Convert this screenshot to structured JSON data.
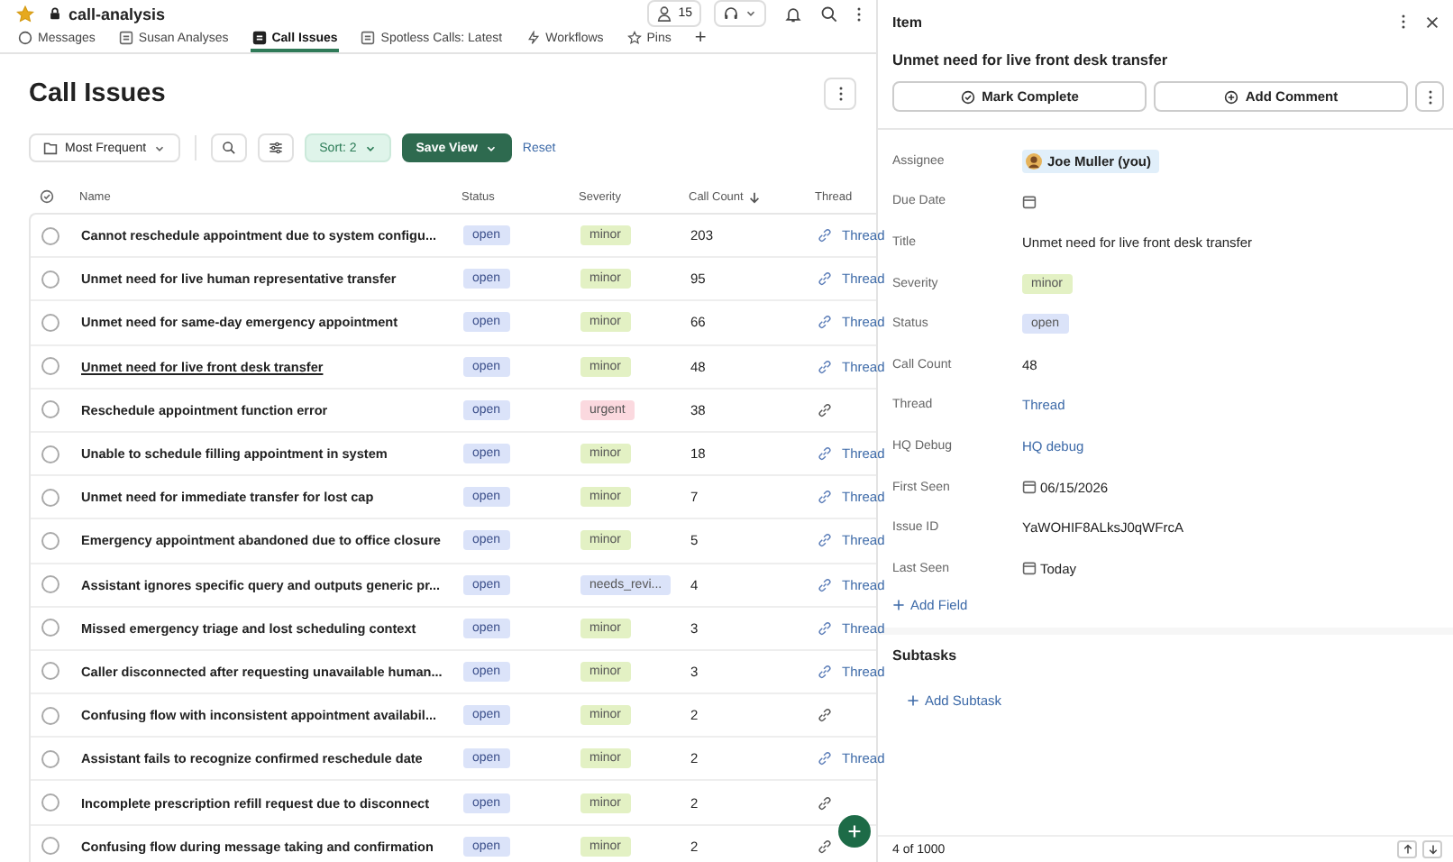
{
  "channel": {
    "name": "call-analysis",
    "starred": true,
    "member_count": "15"
  },
  "tabs": [
    {
      "label": "Messages",
      "kind": "chat",
      "selected": false
    },
    {
      "label": "Susan Analyses",
      "kind": "doc",
      "selected": false
    },
    {
      "label": "Call Issues",
      "kind": "doc",
      "selected": true
    },
    {
      "label": "Spotless Calls: Latest",
      "kind": "doc",
      "selected": false
    },
    {
      "label": "Workflows",
      "kind": "flow",
      "selected": false
    },
    {
      "label": "Pins",
      "kind": "pin",
      "selected": false
    }
  ],
  "add_tab": "+",
  "page_title": "Call Issues",
  "toolbar": {
    "view": "Most Frequent",
    "sort": "Sort: 2",
    "save": "Save View",
    "reset": "Reset"
  },
  "table": {
    "columns": [
      "Name",
      "Status",
      "Severity",
      "Call Count",
      "Thread"
    ],
    "rows": [
      {
        "checked": false,
        "name": "Cannot reschedule appointment due to system configu...",
        "status": "open",
        "severity": {
          "text": "minor",
          "color": "#e3f1c4"
        },
        "count": "203",
        "thread": "Thread",
        "selected": false
      },
      {
        "checked": false,
        "name": "Unmet need for live human representative transfer",
        "status": "open",
        "severity": {
          "text": "minor",
          "color": "#e3f1c4"
        },
        "count": "95",
        "thread": "Thread",
        "selected": false
      },
      {
        "checked": false,
        "name": "Unmet need for same-day emergency appointment",
        "status": "open",
        "severity": {
          "text": "minor",
          "color": "#e3f1c4"
        },
        "count": "66",
        "thread": "Thread",
        "selected": false
      },
      {
        "checked": false,
        "name": "Unmet need for live front desk transfer",
        "status": "open",
        "severity": {
          "text": "minor",
          "color": "#e3f1c4"
        },
        "count": "48",
        "thread": "Thread",
        "selected": true
      },
      {
        "checked": false,
        "name": "Reschedule appointment function error",
        "status": "open",
        "severity": {
          "text": "urgent",
          "color": "#fbd9df"
        },
        "count": "38",
        "selected": false
      },
      {
        "checked": false,
        "name": "Unable to schedule filling appointment in system",
        "status": "open",
        "severity": {
          "text": "minor",
          "color": "#e3f1c4"
        },
        "count": "18",
        "thread": "Thread",
        "selected": false
      },
      {
        "checked": false,
        "name": "Unmet need for immediate transfer for lost cap",
        "status": "open",
        "severity": {
          "text": "minor",
          "color": "#e3f1c4"
        },
        "count": "7",
        "thread": "Thread",
        "selected": false
      },
      {
        "checked": false,
        "name": "Emergency appointment abandoned due to office closure",
        "status": "open",
        "severity": {
          "text": "minor",
          "color": "#e3f1c4"
        },
        "count": "5",
        "thread": "Thread",
        "selected": false
      },
      {
        "checked": false,
        "name": "Assistant ignores specific query and outputs generic pr...",
        "status": "open",
        "severity": {
          "text": "needs_revi...",
          "color": "#dbe3f9"
        },
        "count": "4",
        "thread": "Thread",
        "selected": false
      },
      {
        "checked": false,
        "name": "Missed emergency triage and lost scheduling context",
        "status": "open",
        "severity": {
          "text": "minor",
          "color": "#e3f1c4"
        },
        "count": "3",
        "thread": "Thread",
        "selected": false
      },
      {
        "checked": false,
        "name": "Caller disconnected after requesting unavailable human...",
        "status": "open",
        "severity": {
          "text": "minor",
          "color": "#e3f1c4"
        },
        "count": "3",
        "thread": "Thread",
        "selected": false
      },
      {
        "checked": false,
        "name": "Confusing flow with inconsistent appointment availabil...",
        "status": "open",
        "severity": {
          "text": "minor",
          "color": "#e3f1c4"
        },
        "count": "2",
        "selected": false
      },
      {
        "checked": false,
        "name": "Assistant fails to recognize confirmed reschedule date",
        "status": "open",
        "severity": {
          "text": "minor",
          "color": "#e3f1c4"
        },
        "count": "2",
        "thread": "Thread",
        "selected": false
      },
      {
        "checked": false,
        "name": "Incomplete prescription refill request due to disconnect",
        "status": "open",
        "severity": {
          "text": "minor",
          "color": "#e3f1c4"
        },
        "count": "2",
        "selected": false
      },
      {
        "checked": false,
        "name": "Confusing flow during message taking and confirmation",
        "status": "open",
        "severity": {
          "text": "minor",
          "color": "#e3f1c4"
        },
        "count": "2",
        "selected": false
      }
    ]
  },
  "item_panel": {
    "heading": "Item",
    "title": "Unmet need for live front desk transfer",
    "mark_complete": "Mark Complete",
    "add_comment": "Add Comment",
    "fields": [
      {
        "label": "Assignee",
        "kind": "person",
        "value": "Joe Muller (you)"
      },
      {
        "label": "Due Date",
        "kind": "date"
      },
      {
        "label": "Title",
        "kind": "text",
        "value": "Unmet need for live front desk transfer"
      },
      {
        "label": "Severity",
        "kind": "tag",
        "value": "minor",
        "color": "#e3f1c4"
      },
      {
        "label": "Status",
        "kind": "tag",
        "value": "open",
        "color": "#dbe3f9"
      },
      {
        "label": "Call Count",
        "kind": "text",
        "value": "48"
      },
      {
        "label": "Thread",
        "kind": "link",
        "value": "Thread"
      },
      {
        "label": "HQ Debug",
        "kind": "link",
        "value": "HQ debug"
      },
      {
        "label": "First Seen",
        "kind": "date",
        "value": "06/15/2026"
      },
      {
        "label": "Issue ID",
        "kind": "text",
        "value": "YaWOHIF8ALksJ0qWFrcA"
      },
      {
        "label": "Last Seen",
        "kind": "date",
        "value": "Today"
      }
    ],
    "add_field": "Add Field",
    "subtasks_heading": "Subtasks",
    "add_subtask": "Add Subtask",
    "pager": "4 of 1000"
  }
}
